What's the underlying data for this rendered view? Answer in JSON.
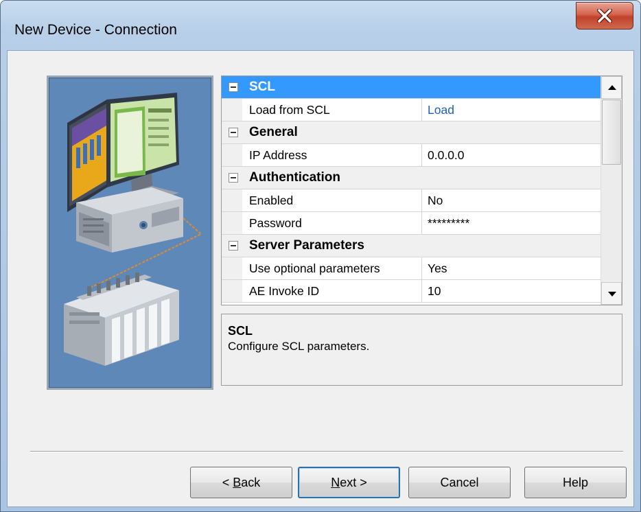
{
  "window": {
    "title": "New Device - Connection",
    "close_glyph": "x"
  },
  "grid": {
    "rows": [
      {
        "type": "category",
        "label": "SCL",
        "selected": true
      },
      {
        "type": "property",
        "name": "Load from SCL",
        "value": "Load",
        "link": true
      },
      {
        "type": "category",
        "label": "General"
      },
      {
        "type": "property",
        "name": "IP Address",
        "value": "0.0.0.0"
      },
      {
        "type": "category",
        "label": "Authentication"
      },
      {
        "type": "property",
        "name": "Enabled",
        "value": "No"
      },
      {
        "type": "property",
        "name": "Password",
        "value": "*********"
      },
      {
        "type": "category",
        "label": "Server Parameters"
      },
      {
        "type": "property",
        "name": "Use optional parameters",
        "value": "Yes"
      },
      {
        "type": "property",
        "name": "AE Invoke ID",
        "value": "10"
      }
    ]
  },
  "description": {
    "title": "SCL",
    "text": "Configure SCL parameters."
  },
  "buttons": {
    "back": {
      "prefix": "< ",
      "mnemonic": "B",
      "rest": "ack"
    },
    "next": {
      "mnemonic": "N",
      "rest": "ext >"
    },
    "cancel": "Cancel",
    "help": "Help"
  },
  "colors": {
    "selection": "#3399ff",
    "link": "#1f5fbf",
    "illustration_bg": "#5e88b8"
  },
  "icons": [
    "close-icon",
    "scroll-up-icon",
    "scroll-down-icon",
    "collapse-icon",
    "computer-illustration",
    "plc-illustration"
  ]
}
